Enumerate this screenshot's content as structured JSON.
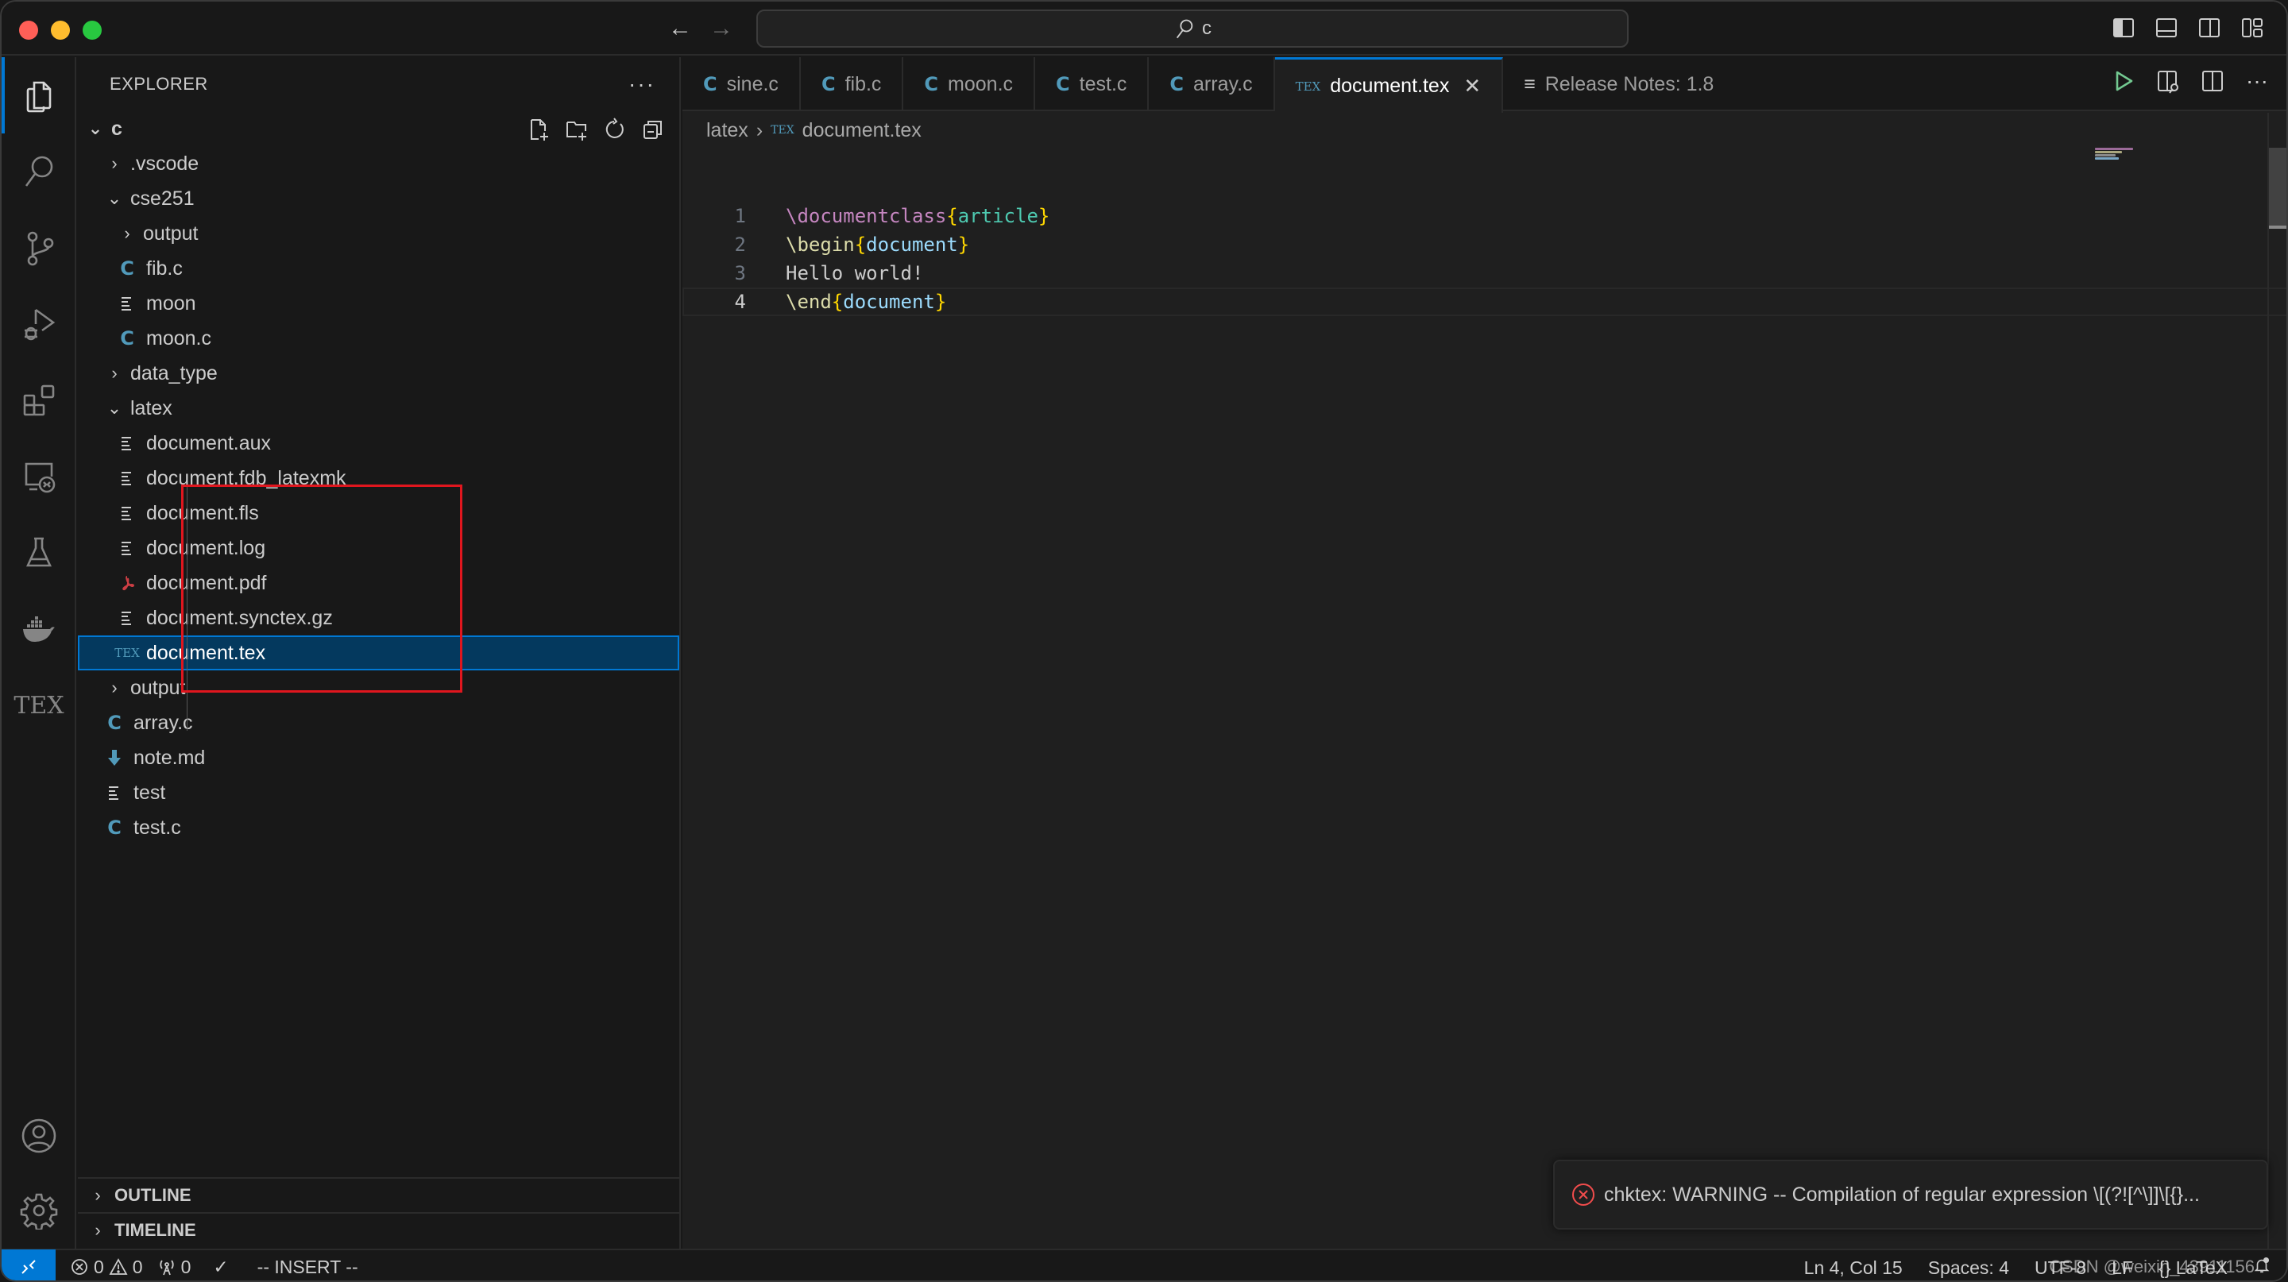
{
  "titlebar": {
    "search_text": "c",
    "back_label": "←",
    "forward_label": "→"
  },
  "activity_bar": {
    "items": [
      {
        "name": "explorer",
        "active": true
      },
      {
        "name": "search"
      },
      {
        "name": "source-control"
      },
      {
        "name": "run-and-debug"
      },
      {
        "name": "extensions"
      },
      {
        "name": "remote-explorer"
      },
      {
        "name": "testing"
      },
      {
        "name": "docker"
      },
      {
        "name": "tex"
      }
    ],
    "bottom": [
      {
        "name": "accounts"
      },
      {
        "name": "manage"
      }
    ],
    "tex_label": "TEX"
  },
  "sidebar": {
    "title": "EXPLORER",
    "more_label": "···",
    "root": {
      "label": "c",
      "expanded": true
    },
    "tree": [
      {
        "label": ".vscode",
        "type": "folder",
        "expanded": false,
        "depth": 1
      },
      {
        "label": "cse251",
        "type": "folder",
        "expanded": true,
        "depth": 1
      },
      {
        "label": "output",
        "type": "folder",
        "expanded": false,
        "depth": 2
      },
      {
        "label": "fib.c",
        "type": "c",
        "depth": 2
      },
      {
        "label": "moon",
        "type": "file",
        "depth": 2
      },
      {
        "label": "moon.c",
        "type": "c",
        "depth": 2
      },
      {
        "label": "data_type",
        "type": "folder",
        "expanded": false,
        "depth": 1
      },
      {
        "label": "latex",
        "type": "folder",
        "expanded": true,
        "depth": 1
      },
      {
        "label": "document.aux",
        "type": "file",
        "depth": 2,
        "highlighted": true
      },
      {
        "label": "document.fdb_latexmk",
        "type": "file",
        "depth": 2,
        "highlighted": true
      },
      {
        "label": "document.fls",
        "type": "file",
        "depth": 2,
        "highlighted": true
      },
      {
        "label": "document.log",
        "type": "file",
        "depth": 2,
        "highlighted": true
      },
      {
        "label": "document.pdf",
        "type": "pdf",
        "depth": 2,
        "highlighted": true
      },
      {
        "label": "document.synctex.gz",
        "type": "file",
        "depth": 2,
        "highlighted": true
      },
      {
        "label": "document.tex",
        "type": "tex",
        "depth": 2,
        "selected": true
      },
      {
        "label": "output",
        "type": "folder",
        "expanded": false,
        "depth": 1
      },
      {
        "label": "array.c",
        "type": "c",
        "depth": 1
      },
      {
        "label": "note.md",
        "type": "md",
        "depth": 1
      },
      {
        "label": "test",
        "type": "file",
        "depth": 1
      },
      {
        "label": "test.c",
        "type": "c",
        "depth": 1
      }
    ],
    "sections": {
      "outline": "OUTLINE",
      "timeline": "TIMELINE"
    },
    "icon_text": {
      "c": "C",
      "tex": "TEX",
      "chev_closed": "›",
      "chev_open": "⌄"
    }
  },
  "editor": {
    "tabs": [
      {
        "label": "sine.c",
        "icon": "C"
      },
      {
        "label": "fib.c",
        "icon": "C"
      },
      {
        "label": "moon.c",
        "icon": "C"
      },
      {
        "label": "test.c",
        "icon": "C"
      },
      {
        "label": "array.c",
        "icon": "C"
      },
      {
        "label": "document.tex",
        "icon": "TEX",
        "active": true,
        "close": "✕"
      },
      {
        "label": "Release Notes: 1.8",
        "icon": "≡"
      }
    ],
    "breadcrumb": {
      "folder": "latex",
      "separator": "›",
      "file_icon": "TEX",
      "file": "document.tex"
    },
    "lines": [
      {
        "number": "1",
        "tokens": [
          {
            "t": "\\documentclass",
            "c": "kw-purple"
          },
          {
            "t": "{",
            "c": "brace"
          },
          {
            "t": "article",
            "c": "arg-green"
          },
          {
            "t": "}",
            "c": "brace"
          }
        ]
      },
      {
        "number": "2",
        "tokens": [
          {
            "t": "\\begin",
            "c": "kw-yellow"
          },
          {
            "t": "{",
            "c": "brace"
          },
          {
            "t": "document",
            "c": "arg-blue"
          },
          {
            "t": "}",
            "c": "brace"
          }
        ]
      },
      {
        "number": "3",
        "tokens": [
          {
            "t": "Hello world!",
            "c": ""
          }
        ]
      },
      {
        "number": "4",
        "tokens": [
          {
            "t": "\\end",
            "c": "kw-yellow"
          },
          {
            "t": "{",
            "c": "brace"
          },
          {
            "t": "document",
            "c": "arg-blue"
          },
          {
            "t": "}",
            "c": "brace"
          }
        ],
        "current": true
      }
    ],
    "more_label": "···"
  },
  "notification": {
    "severity": "error",
    "message": "chktex: WARNING -- Compilation of regular expression \\[(?![^\\]]\\[{}..."
  },
  "statusbar": {
    "errors": "0",
    "warnings": "0",
    "ports": "0",
    "check": "✓",
    "mode": "-- INSERT --",
    "position": "Ln 4, Col 15",
    "indent": "Spaces: 4",
    "encoding": "UTF-8",
    "eol": "LF",
    "language_icon": "{}",
    "language": "LaTeX",
    "watermark": "CSDN @weixin_43911156"
  },
  "colors": {
    "accent": "#0078d4",
    "selection_bg": "#04395e",
    "highlight_box": "#e0161e",
    "c_icon": "#519aba",
    "pdf_icon": "#cc3e44",
    "run_green": "#73c991",
    "error_red": "#f14c4c"
  }
}
